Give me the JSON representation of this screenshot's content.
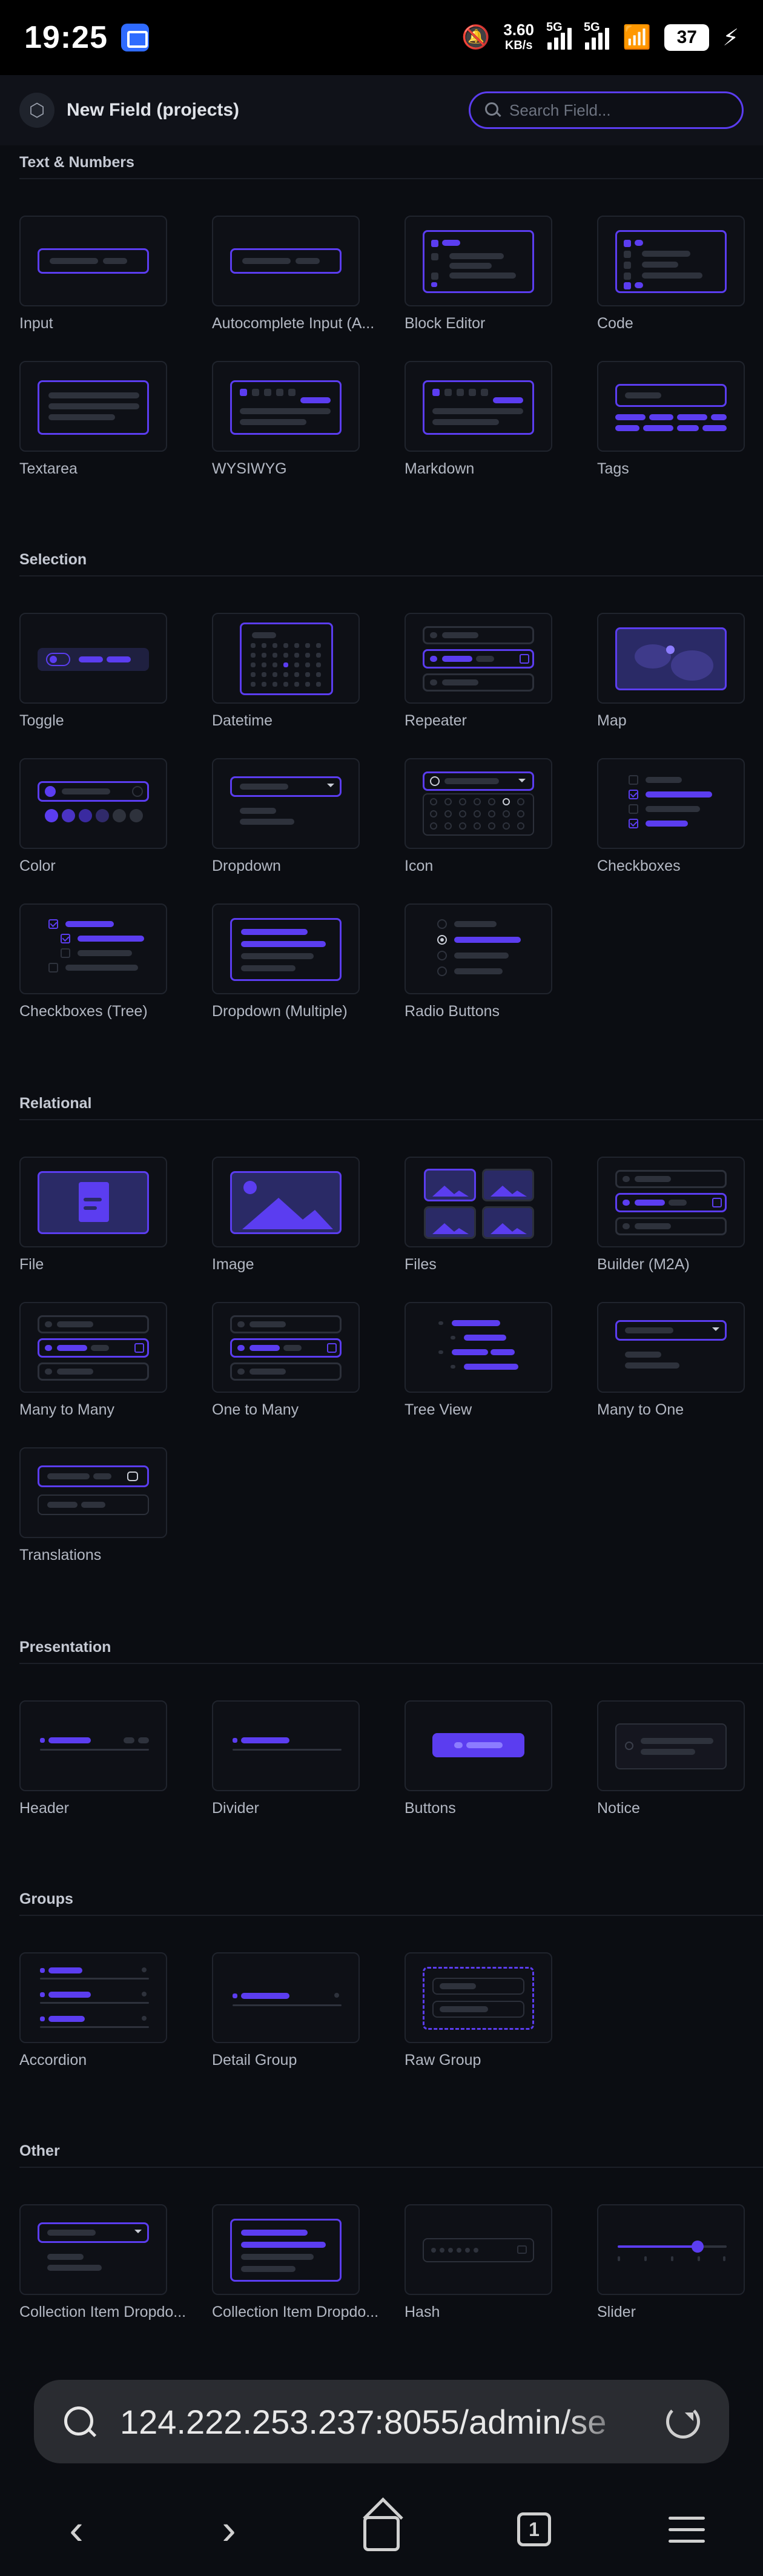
{
  "status_bar": {
    "time": "19:25",
    "net_speed_value": "3.60",
    "net_speed_unit": "KB/s",
    "signal1_label": "5G",
    "signal2_label": "5G",
    "battery": "37"
  },
  "header": {
    "title": "New Field (projects)",
    "search_placeholder": "Search Field..."
  },
  "sections": {
    "text_numbers": {
      "title": "Text & Numbers",
      "items": [
        "Input",
        "Autocomplete Input (A...",
        "Block Editor",
        "Code",
        "Textarea",
        "WYSIWYG",
        "Markdown",
        "Tags"
      ]
    },
    "selection": {
      "title": "Selection",
      "items": [
        "Toggle",
        "Datetime",
        "Repeater",
        "Map",
        "Color",
        "Dropdown",
        "Icon",
        "Checkboxes",
        "Checkboxes (Tree)",
        "Dropdown (Multiple)",
        "Radio Buttons"
      ]
    },
    "relational": {
      "title": "Relational",
      "items": [
        "File",
        "Image",
        "Files",
        "Builder (M2A)",
        "Many to Many",
        "One to Many",
        "Tree View",
        "Many to One",
        "Translations"
      ]
    },
    "presentation": {
      "title": "Presentation",
      "items": [
        "Header",
        "Divider",
        "Buttons",
        "Notice"
      ]
    },
    "groups": {
      "title": "Groups",
      "items": [
        "Accordion",
        "Detail Group",
        "Raw Group"
      ]
    },
    "other": {
      "title": "Other",
      "items": [
        "Collection Item Dropdo...",
        "Collection Item Dropdo...",
        "Hash",
        "Slider"
      ]
    }
  },
  "browser": {
    "url": "124.222.253.237:8055/admin/se",
    "tab_count": "1"
  },
  "colors": {
    "accent": "#5b3df0",
    "background": "#0b0d12",
    "panel": "#101219"
  }
}
